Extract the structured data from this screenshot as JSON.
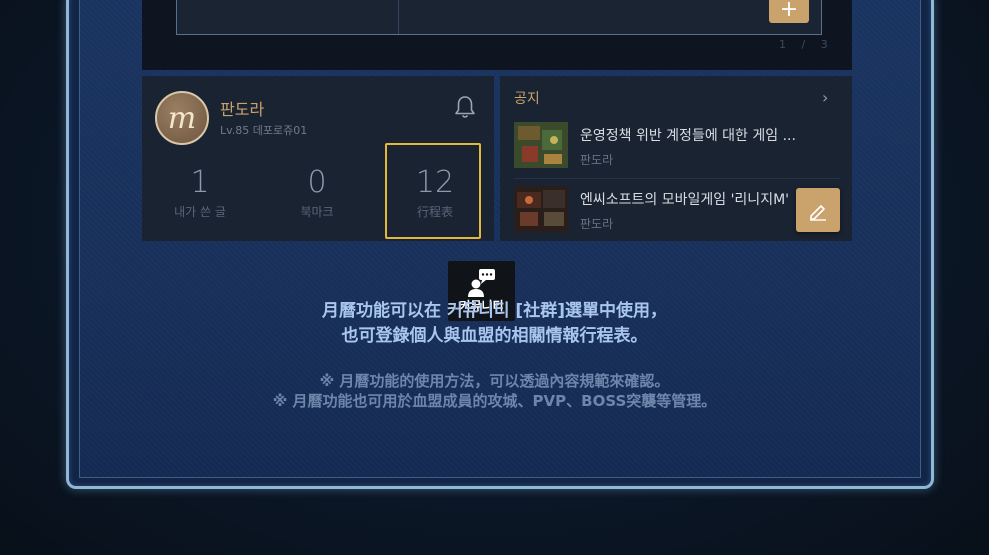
{
  "top": {
    "plus_label": "+",
    "pager": "1 / 3"
  },
  "profile": {
    "avatar_glyph": "m",
    "name": "판도라",
    "level": "Lv.85 데포로쥬01",
    "stats": [
      {
        "value": "1",
        "label": "내가 쓴 글"
      },
      {
        "value": "0",
        "label": "북마크"
      },
      {
        "value": "12",
        "label": "行程表"
      }
    ]
  },
  "notice": {
    "title": "공지",
    "items": [
      {
        "text": "운영정책 위반 계정들에 대한 게임 ...",
        "author": "판도라"
      },
      {
        "text": "엔씨소프트의 모바일게임 '리니지M'",
        "author": "판도라"
      }
    ]
  },
  "community": {
    "label": "커뮤니티"
  },
  "description": {
    "line1": "月曆功能可以在 커뮤니티 [社群]選單中使用，",
    "line2": "也可登錄個人與血盟的相關情報行程表。",
    "note1": "※ 月曆功能的使用方法，可以透過內容規範來確認。",
    "note2": "※ 月曆功能也可用於血盟成員的攻城、PVP、BOSS突襲等管理。"
  },
  "colors": {
    "accent": "#c9a26c",
    "highlight": "#e4b93a",
    "text_blue": "#a9c6ef"
  },
  "icons": [
    "bell-icon",
    "chevron-right-icon",
    "pencil-icon",
    "plus-icon",
    "chat-user-icon"
  ]
}
